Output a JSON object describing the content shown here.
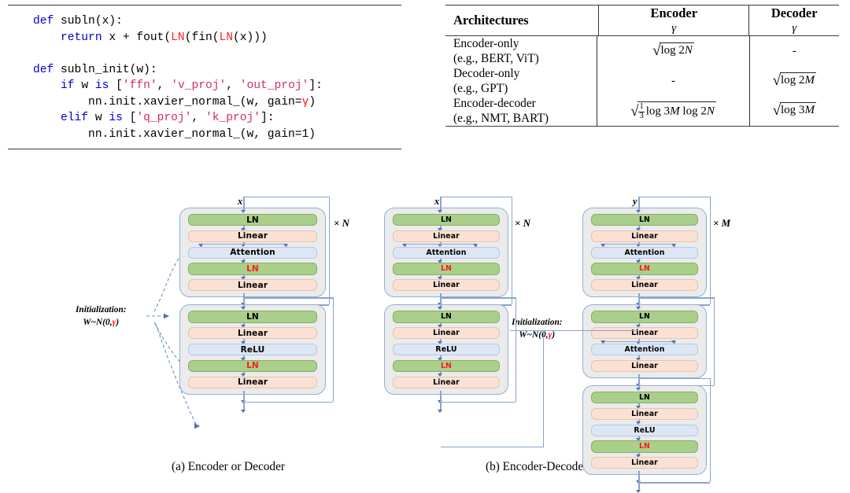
{
  "code_panel": {
    "lines": [
      [
        {
          "t": "def ",
          "c": "kw"
        },
        {
          "t": "subln(x):",
          "c": ""
        }
      ],
      [
        {
          "t": "    ",
          "c": ""
        },
        {
          "t": "return ",
          "c": "kw"
        },
        {
          "t": "x + fout(",
          "c": ""
        },
        {
          "t": "LN",
          "c": "fn-ln"
        },
        {
          "t": "(fin(",
          "c": ""
        },
        {
          "t": "LN",
          "c": "fn-ln"
        },
        {
          "t": "(x)))",
          "c": ""
        }
      ],
      [],
      [
        {
          "t": "def ",
          "c": "kw"
        },
        {
          "t": "subln_init(w):",
          "c": ""
        }
      ],
      [
        {
          "t": "    ",
          "c": ""
        },
        {
          "t": "if ",
          "c": "kw"
        },
        {
          "t": "w ",
          "c": ""
        },
        {
          "t": "is ",
          "c": "kw"
        },
        {
          "t": "[",
          "c": ""
        },
        {
          "t": "'ffn'",
          "c": "str"
        },
        {
          "t": ", ",
          "c": ""
        },
        {
          "t": "'v_proj'",
          "c": "str"
        },
        {
          "t": ", ",
          "c": ""
        },
        {
          "t": "'out_proj'",
          "c": "str"
        },
        {
          "t": "]:",
          "c": ""
        }
      ],
      [
        {
          "t": "        nn.init.xavier_normal_(w, gain=",
          "c": ""
        },
        {
          "t": "γ",
          "c": "gam"
        },
        {
          "t": ")",
          "c": ""
        }
      ],
      [
        {
          "t": "    ",
          "c": ""
        },
        {
          "t": "elif ",
          "c": "kw"
        },
        {
          "t": "w ",
          "c": ""
        },
        {
          "t": "is ",
          "c": "kw"
        },
        {
          "t": "[",
          "c": ""
        },
        {
          "t": "'q_proj'",
          "c": "str"
        },
        {
          "t": ", ",
          "c": ""
        },
        {
          "t": "'k_proj'",
          "c": "str"
        },
        {
          "t": "]:",
          "c": ""
        }
      ],
      [
        {
          "t": "        nn.init.xavier_normal_(w, gain=1)",
          "c": ""
        }
      ]
    ]
  },
  "table": {
    "headers": {
      "architectures": "Architectures",
      "encoder": "Encoder",
      "encoder_sub": "γ",
      "decoder": "Decoder",
      "decoder_sub": "γ"
    },
    "rows": [
      {
        "name": "Encoder-only",
        "examples": "(e.g., BERT, ViT)",
        "encoder": "√(log 2N)",
        "encoder_inner": "log 2N",
        "decoder": "-",
        "decoder_inner": ""
      },
      {
        "name": "Decoder-only",
        "examples": "(e.g., GPT)",
        "encoder": "-",
        "encoder_inner": "",
        "decoder": "√(log 2M)",
        "decoder_inner": "log 2M"
      },
      {
        "name": "Encoder-decoder",
        "examples": "(e.g., NMT, BART)",
        "encoder": "√(1/3 log 3M log 2N)",
        "encoder_inner": "log 3M log 2N",
        "decoder": "√(log 3M)",
        "decoder_inner": "log 3M"
      }
    ],
    "frac": {
      "num": "1",
      "den": "3"
    }
  },
  "figure": {
    "colors": {
      "ln": "#a9cf8b",
      "linear": "#fae1d4",
      "activation": "#dce6f5",
      "group_bg": "#ebebeb",
      "connector": "#8aa4cf",
      "red": "#ff1a1a"
    },
    "labels": {
      "ln": "LN",
      "linear": "Linear",
      "attention": "Attention",
      "relu": "ReLU",
      "input_x": "x",
      "input_y": "y",
      "times_n": "× N",
      "times_m": "× M",
      "init_line1": "Initialization:",
      "init_line2_pre": "W~N(0,",
      "init_line2_gamma": "γ",
      "init_line2_post": ")"
    },
    "captions": {
      "a": "(a) Encoder or Decoder",
      "b": "(b) Encoder-Decoder"
    },
    "columns": [
      {
        "id": "encoder-or-decoder",
        "input": "x",
        "repeat": "× N",
        "blocks": [
          {
            "id": "attention-sublayer",
            "rows": [
              {
                "label": "LN",
                "kind": "ln",
                "red": false
              },
              {
                "label": "Linear",
                "kind": "lin",
                "red": false
              },
              {
                "label": "Attention",
                "kind": "act",
                "red": false
              },
              {
                "label": "LN",
                "kind": "ln",
                "red": true
              },
              {
                "label": "Linear",
                "kind": "lin",
                "red": false
              }
            ]
          },
          {
            "id": "ffn-sublayer",
            "rows": [
              {
                "label": "LN",
                "kind": "ln",
                "red": false
              },
              {
                "label": "Linear",
                "kind": "lin",
                "red": false
              },
              {
                "label": "ReLU",
                "kind": "act",
                "red": false
              },
              {
                "label": "LN",
                "kind": "ln",
                "red": true
              },
              {
                "label": "Linear",
                "kind": "lin",
                "red": false
              }
            ]
          }
        ]
      },
      {
        "id": "encoder-column",
        "input": "x",
        "repeat": "× N",
        "blocks": [
          {
            "id": "enc-attention-sublayer",
            "rows": [
              {
                "label": "LN",
                "kind": "ln",
                "red": false
              },
              {
                "label": "Linear",
                "kind": "lin",
                "red": false
              },
              {
                "label": "Attention",
                "kind": "act",
                "red": false
              },
              {
                "label": "LN",
                "kind": "ln",
                "red": true
              },
              {
                "label": "Linear",
                "kind": "lin",
                "red": false
              }
            ]
          },
          {
            "id": "enc-ffn-sublayer",
            "rows": [
              {
                "label": "LN",
                "kind": "ln",
                "red": false
              },
              {
                "label": "Linear",
                "kind": "lin",
                "red": false
              },
              {
                "label": "ReLU",
                "kind": "act",
                "red": false
              },
              {
                "label": "LN",
                "kind": "ln",
                "red": true
              },
              {
                "label": "Linear",
                "kind": "lin",
                "red": false
              }
            ]
          }
        ]
      },
      {
        "id": "decoder-column",
        "input": "y",
        "repeat": "× M",
        "blocks": [
          {
            "id": "dec-self-attention-sublayer",
            "rows": [
              {
                "label": "LN",
                "kind": "ln",
                "red": false
              },
              {
                "label": "Linear",
                "kind": "lin",
                "red": false
              },
              {
                "label": "Attention",
                "kind": "act",
                "red": false
              },
              {
                "label": "LN",
                "kind": "ln",
                "red": true
              },
              {
                "label": "Linear",
                "kind": "lin",
                "red": false
              }
            ]
          },
          {
            "id": "dec-cross-attention-sublayer",
            "rows": [
              {
                "label": "LN",
                "kind": "ln",
                "red": false
              },
              {
                "label": "Linear",
                "kind": "lin",
                "red": false
              },
              {
                "label": "Attention",
                "kind": "act",
                "red": false
              },
              {
                "label": "Linear",
                "kind": "lin",
                "red": false
              }
            ]
          },
          {
            "id": "dec-ffn-sublayer",
            "rows": [
              {
                "label": "LN",
                "kind": "ln",
                "red": false
              },
              {
                "label": "Linear",
                "kind": "lin",
                "red": false
              },
              {
                "label": "ReLU",
                "kind": "act",
                "red": false
              },
              {
                "label": "LN",
                "kind": "ln",
                "red": true
              },
              {
                "label": "Linear",
                "kind": "lin",
                "red": false
              }
            ]
          }
        ]
      }
    ]
  }
}
